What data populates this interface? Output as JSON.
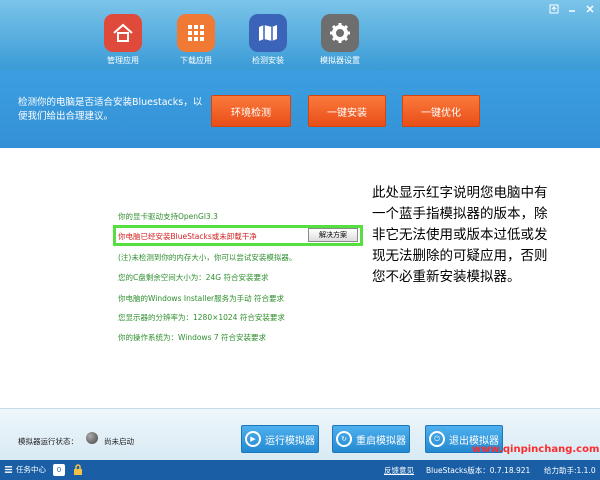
{
  "window": {
    "ctrl_icons": [
      "upload-icon",
      "minimize-icon",
      "close-icon"
    ]
  },
  "nav": [
    {
      "label": "管理应用",
      "icon": "home-icon",
      "color": "#e04a3a"
    },
    {
      "label": "下载应用",
      "icon": "grid-icon",
      "color": "#f07a34"
    },
    {
      "label": "检测安装",
      "icon": "map-icon",
      "color": "#3b63b8"
    },
    {
      "label": "模拟器设置",
      "icon": "gear-icon",
      "color": "#6e6e6e"
    }
  ],
  "band": {
    "text": "检测你的电脑是否适合安装Bluestacks，以便我们给出合理建议。",
    "buttons": [
      "环境检测",
      "一键安装",
      "一键优化"
    ]
  },
  "checks": [
    {
      "text": "你的显卡驱动支持OpenGl3.3",
      "status": "ok"
    },
    {
      "text": "你电脑已经安装BlueStacks或未卸载干净",
      "status": "error"
    },
    {
      "text": "(注)未检测到你的内存大小，你可以尝试安装模拟器。",
      "status": "ok"
    },
    {
      "text": "您的C盘剩余空间大小为：24G 符合安装要求",
      "status": "ok"
    },
    {
      "text": "你电脑的Windows Installer服务为手动 符合要求",
      "status": "ok"
    },
    {
      "text": "您显示器的分辨率为：1280×1024 符合安装要求",
      "status": "ok"
    },
    {
      "text": "你的操作系统为：Windows 7 符合安装要求",
      "status": "ok"
    }
  ],
  "fix_button": "解决方案",
  "note": "此处显示红字说明您电脑中有一个蓝手指模拟器的版本，除非它无法使用或版本过低或发现无法删除的可疑应用，否则您不必重新安装模拟器。",
  "footer": {
    "status_label": "模拟器运行状态：",
    "status_value": "尚未启动",
    "buttons": [
      "运行模拟器",
      "重启模拟器",
      "退出模拟器"
    ]
  },
  "taskbar": {
    "start": "任务中心",
    "badge": "0",
    "feedback": "反馈意见",
    "version": "BlueStacks版本：0.7.18.921",
    "helper": "给力助手:1.1.0"
  },
  "watermark": "www.qinpinchang.com"
}
